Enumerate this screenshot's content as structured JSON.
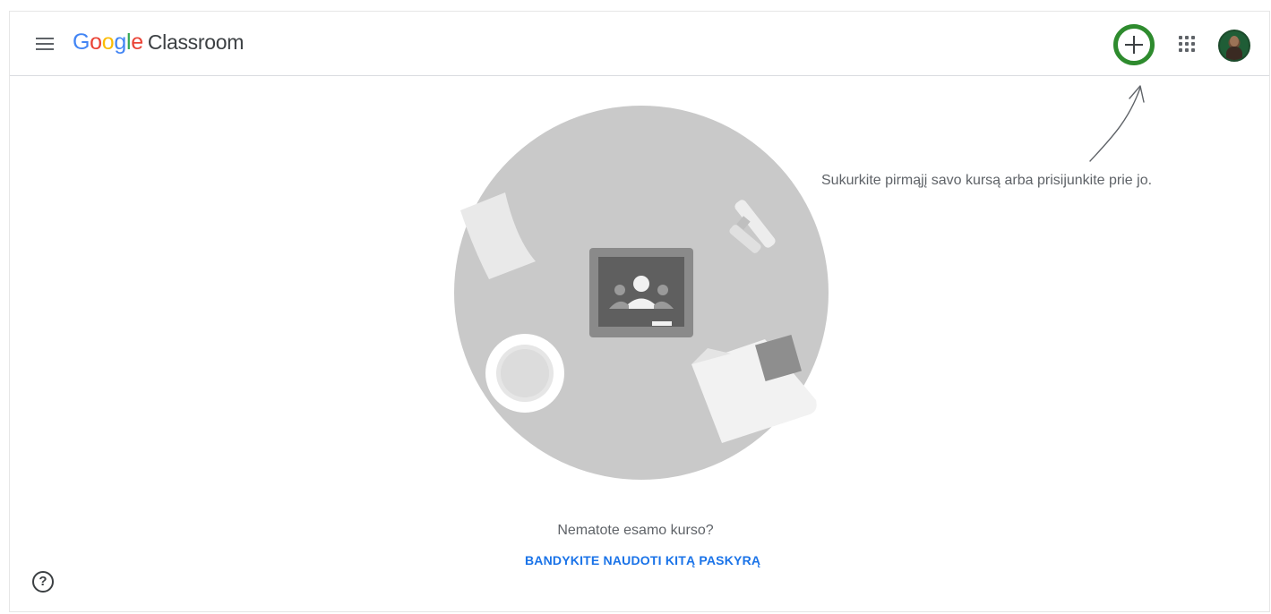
{
  "header": {
    "logo_letters": [
      {
        "char": "G",
        "color": "#4285F4"
      },
      {
        "char": "o",
        "color": "#EA4335"
      },
      {
        "char": "o",
        "color": "#FBBC05"
      },
      {
        "char": "g",
        "color": "#4285F4"
      },
      {
        "char": "l",
        "color": "#34A853"
      },
      {
        "char": "e",
        "color": "#EA4335"
      }
    ],
    "app_name": "Classroom",
    "menu_icon": "hamburger-menu-icon",
    "add_icon": "plus-icon",
    "apps_icon": "apps-grid-icon",
    "avatar_icon": "user-avatar",
    "add_highlight_color": "#2e8b2e"
  },
  "hint": {
    "text": "Sukurkite pirmąjį savo kursą arba prisijunkite prie jo."
  },
  "empty_state": {
    "message": "Nematote esamo kurso?",
    "link_label": "BANDYKITE NAUDOTI KITĄ PASKYRĄ",
    "link_color": "#1a73e8"
  },
  "footer": {
    "help_label": "?",
    "help_icon": "help-circle-icon"
  }
}
